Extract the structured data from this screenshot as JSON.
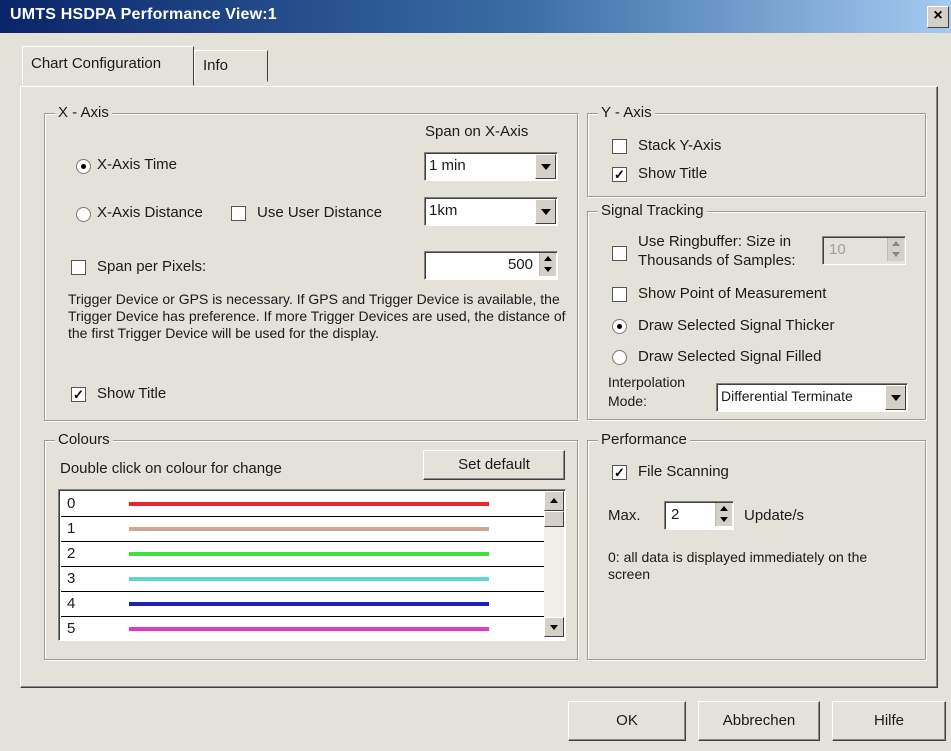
{
  "window": {
    "title": "UMTS HSDPA Performance View:1",
    "close_glyph": "×"
  },
  "tabs": [
    {
      "label": "Chart Configuration"
    },
    {
      "label": "Info"
    }
  ],
  "x_axis": {
    "group_label": "X - Axis",
    "span_label": "Span on X-Axis",
    "time_label": "X-Axis Time",
    "time_selected": true,
    "time_span": "1 min",
    "distance_label": "X-Axis Distance",
    "use_user_distance_label": "Use User Distance",
    "use_user_distance_checked": false,
    "distance_span": "1km",
    "span_per_pixels_label": "Span per Pixels:",
    "span_per_pixels_checked": false,
    "span_per_pixels_value": "500",
    "note": "Trigger Device or GPS is necessary. If GPS and Trigger Device is available, the Trigger Device has preference. If more Trigger Devices are used, the distance of the first Trigger Device will be used for the display.",
    "show_title_label": "Show Title",
    "show_title_checked": true
  },
  "y_axis": {
    "group_label": "Y - Axis",
    "stack_label": "Stack Y-Axis",
    "stack_checked": false,
    "show_title_label": "Show Title",
    "show_title_checked": true
  },
  "signal_tracking": {
    "group_label": "Signal Tracking",
    "ringbuffer_label_1": "Use Ringbuffer: Size in",
    "ringbuffer_label_2": "Thousands of Samples:",
    "ringbuffer_checked": false,
    "ringbuffer_value": "10",
    "point_label": "Show Point of Measurement",
    "point_checked": false,
    "thicker_label": "Draw Selected Signal Thicker",
    "thicker_selected": true,
    "filled_label": "Draw Selected Signal Filled",
    "filled_selected": false,
    "interp_label_1": "Interpolation",
    "interp_label_2": "Mode:",
    "interp_value": "Differential Terminate"
  },
  "colours": {
    "group_label": "Colours",
    "hint": "Double click on colour for change",
    "set_default_label": "Set default",
    "items": [
      {
        "index": "0",
        "color": "#e8262a"
      },
      {
        "index": "1",
        "color": "#c9a893"
      },
      {
        "index": "2",
        "color": "#3fe23a"
      },
      {
        "index": "3",
        "color": "#5fd3d7"
      },
      {
        "index": "4",
        "color": "#1a22b8"
      },
      {
        "index": "5",
        "color": "#e03ac8"
      }
    ]
  },
  "performance": {
    "group_label": "Performance",
    "file_scanning_label": "File Scanning",
    "file_scanning_checked": true,
    "max_label": "Max.",
    "max_value": "2",
    "update_label": "Update/s",
    "note": "0: all data is displayed immediately on the screen"
  },
  "footer": {
    "ok_label": "OK",
    "cancel_label": "Abbrechen",
    "help_label": "Hilfe"
  }
}
